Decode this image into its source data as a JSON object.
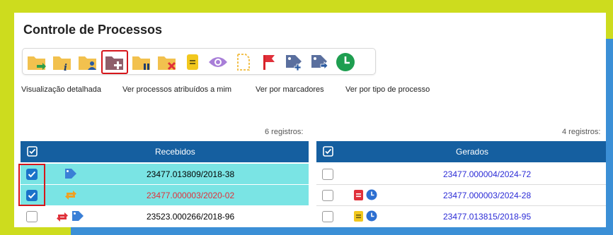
{
  "page": {
    "title": "Controle de Processos"
  },
  "toolbar": {
    "buttons": [
      {
        "icon": "folder-send-icon"
      },
      {
        "icon": "folder-info-icon"
      },
      {
        "icon": "folder-user-icon"
      },
      {
        "icon": "folder-add-icon",
        "highlighted": true
      },
      {
        "icon": "folder-pause-icon"
      },
      {
        "icon": "folder-close-icon"
      },
      {
        "icon": "note-icon"
      },
      {
        "icon": "eye-icon"
      },
      {
        "icon": "document-outline-icon"
      },
      {
        "icon": "flag-icon"
      },
      {
        "icon": "tag-add-icon"
      },
      {
        "icon": "tag-remove-icon"
      },
      {
        "icon": "clock-icon"
      }
    ]
  },
  "links": {
    "detailed": "Visualização detalhada",
    "assigned": "Ver processos atribuídos a mim",
    "markers": "Ver por marcadores",
    "type": "Ver por tipo de processo"
  },
  "recebidos": {
    "count": "6 registros:",
    "header": "Recebidos",
    "rows": [
      {
        "process": "23477.013809/2018-38",
        "checked": true,
        "selected": true,
        "color": "#222222",
        "icons": [
          "tag-icon"
        ]
      },
      {
        "process": "23477.000003/2020-02",
        "checked": true,
        "selected": true,
        "color": "#e0303a",
        "icons": [
          "arrows-exchange-icon"
        ]
      },
      {
        "process": "23523.000266/2018-96",
        "checked": false,
        "selected": false,
        "color": "#222222",
        "icons": [
          "arrows-exchange-icon",
          "tag-icon"
        ]
      }
    ]
  },
  "gerados": {
    "count": "4 registros:",
    "header": "Gerados",
    "rows": [
      {
        "process": "23477.000004/2024-72",
        "checked": false,
        "color": "#2b2bd6",
        "icons": []
      },
      {
        "process": "23477.000003/2024-28",
        "checked": false,
        "color": "#2b2bd6",
        "icons": [
          "red-note-icon",
          "clock-icon"
        ]
      },
      {
        "process": "23477.013815/2018-95",
        "checked": false,
        "color": "#2b2bd6",
        "icons": [
          "yellow-note-icon",
          "clock-icon"
        ]
      }
    ]
  },
  "colors": {
    "header": "#155fa0",
    "selected_row": "#7ae4e4",
    "highlight": "#d6161b",
    "frame_yellow": "#cddc1e",
    "frame_blue": "#3b8fd6"
  }
}
